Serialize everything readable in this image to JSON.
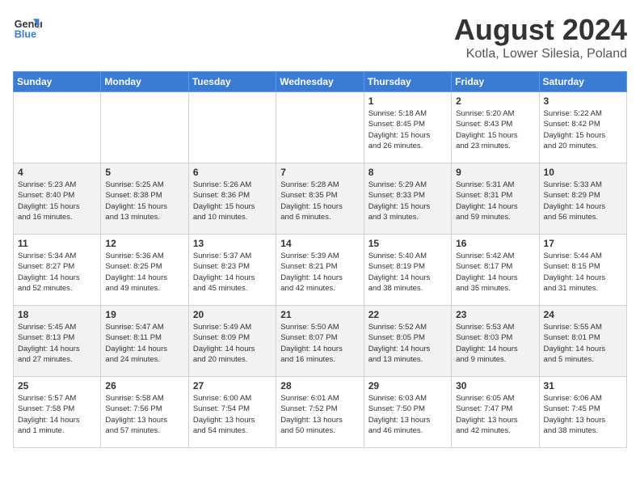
{
  "header": {
    "logo_line1": "General",
    "logo_line2": "Blue",
    "title": "August 2024",
    "subtitle": "Kotla, Lower Silesia, Poland"
  },
  "weekdays": [
    "Sunday",
    "Monday",
    "Tuesday",
    "Wednesday",
    "Thursday",
    "Friday",
    "Saturday"
  ],
  "weeks": [
    [
      {
        "num": "",
        "info": ""
      },
      {
        "num": "",
        "info": ""
      },
      {
        "num": "",
        "info": ""
      },
      {
        "num": "",
        "info": ""
      },
      {
        "num": "1",
        "info": "Sunrise: 5:18 AM\nSunset: 8:45 PM\nDaylight: 15 hours\nand 26 minutes."
      },
      {
        "num": "2",
        "info": "Sunrise: 5:20 AM\nSunset: 8:43 PM\nDaylight: 15 hours\nand 23 minutes."
      },
      {
        "num": "3",
        "info": "Sunrise: 5:22 AM\nSunset: 8:42 PM\nDaylight: 15 hours\nand 20 minutes."
      }
    ],
    [
      {
        "num": "4",
        "info": "Sunrise: 5:23 AM\nSunset: 8:40 PM\nDaylight: 15 hours\nand 16 minutes."
      },
      {
        "num": "5",
        "info": "Sunrise: 5:25 AM\nSunset: 8:38 PM\nDaylight: 15 hours\nand 13 minutes."
      },
      {
        "num": "6",
        "info": "Sunrise: 5:26 AM\nSunset: 8:36 PM\nDaylight: 15 hours\nand 10 minutes."
      },
      {
        "num": "7",
        "info": "Sunrise: 5:28 AM\nSunset: 8:35 PM\nDaylight: 15 hours\nand 6 minutes."
      },
      {
        "num": "8",
        "info": "Sunrise: 5:29 AM\nSunset: 8:33 PM\nDaylight: 15 hours\nand 3 minutes."
      },
      {
        "num": "9",
        "info": "Sunrise: 5:31 AM\nSunset: 8:31 PM\nDaylight: 14 hours\nand 59 minutes."
      },
      {
        "num": "10",
        "info": "Sunrise: 5:33 AM\nSunset: 8:29 PM\nDaylight: 14 hours\nand 56 minutes."
      }
    ],
    [
      {
        "num": "11",
        "info": "Sunrise: 5:34 AM\nSunset: 8:27 PM\nDaylight: 14 hours\nand 52 minutes."
      },
      {
        "num": "12",
        "info": "Sunrise: 5:36 AM\nSunset: 8:25 PM\nDaylight: 14 hours\nand 49 minutes."
      },
      {
        "num": "13",
        "info": "Sunrise: 5:37 AM\nSunset: 8:23 PM\nDaylight: 14 hours\nand 45 minutes."
      },
      {
        "num": "14",
        "info": "Sunrise: 5:39 AM\nSunset: 8:21 PM\nDaylight: 14 hours\nand 42 minutes."
      },
      {
        "num": "15",
        "info": "Sunrise: 5:40 AM\nSunset: 8:19 PM\nDaylight: 14 hours\nand 38 minutes."
      },
      {
        "num": "16",
        "info": "Sunrise: 5:42 AM\nSunset: 8:17 PM\nDaylight: 14 hours\nand 35 minutes."
      },
      {
        "num": "17",
        "info": "Sunrise: 5:44 AM\nSunset: 8:15 PM\nDaylight: 14 hours\nand 31 minutes."
      }
    ],
    [
      {
        "num": "18",
        "info": "Sunrise: 5:45 AM\nSunset: 8:13 PM\nDaylight: 14 hours\nand 27 minutes."
      },
      {
        "num": "19",
        "info": "Sunrise: 5:47 AM\nSunset: 8:11 PM\nDaylight: 14 hours\nand 24 minutes."
      },
      {
        "num": "20",
        "info": "Sunrise: 5:49 AM\nSunset: 8:09 PM\nDaylight: 14 hours\nand 20 minutes."
      },
      {
        "num": "21",
        "info": "Sunrise: 5:50 AM\nSunset: 8:07 PM\nDaylight: 14 hours\nand 16 minutes."
      },
      {
        "num": "22",
        "info": "Sunrise: 5:52 AM\nSunset: 8:05 PM\nDaylight: 14 hours\nand 13 minutes."
      },
      {
        "num": "23",
        "info": "Sunrise: 5:53 AM\nSunset: 8:03 PM\nDaylight: 14 hours\nand 9 minutes."
      },
      {
        "num": "24",
        "info": "Sunrise: 5:55 AM\nSunset: 8:01 PM\nDaylight: 14 hours\nand 5 minutes."
      }
    ],
    [
      {
        "num": "25",
        "info": "Sunrise: 5:57 AM\nSunset: 7:58 PM\nDaylight: 14 hours\nand 1 minute."
      },
      {
        "num": "26",
        "info": "Sunrise: 5:58 AM\nSunset: 7:56 PM\nDaylight: 13 hours\nand 57 minutes."
      },
      {
        "num": "27",
        "info": "Sunrise: 6:00 AM\nSunset: 7:54 PM\nDaylight: 13 hours\nand 54 minutes."
      },
      {
        "num": "28",
        "info": "Sunrise: 6:01 AM\nSunset: 7:52 PM\nDaylight: 13 hours\nand 50 minutes."
      },
      {
        "num": "29",
        "info": "Sunrise: 6:03 AM\nSunset: 7:50 PM\nDaylight: 13 hours\nand 46 minutes."
      },
      {
        "num": "30",
        "info": "Sunrise: 6:05 AM\nSunset: 7:47 PM\nDaylight: 13 hours\nand 42 minutes."
      },
      {
        "num": "31",
        "info": "Sunrise: 6:06 AM\nSunset: 7:45 PM\nDaylight: 13 hours\nand 38 minutes."
      }
    ]
  ]
}
